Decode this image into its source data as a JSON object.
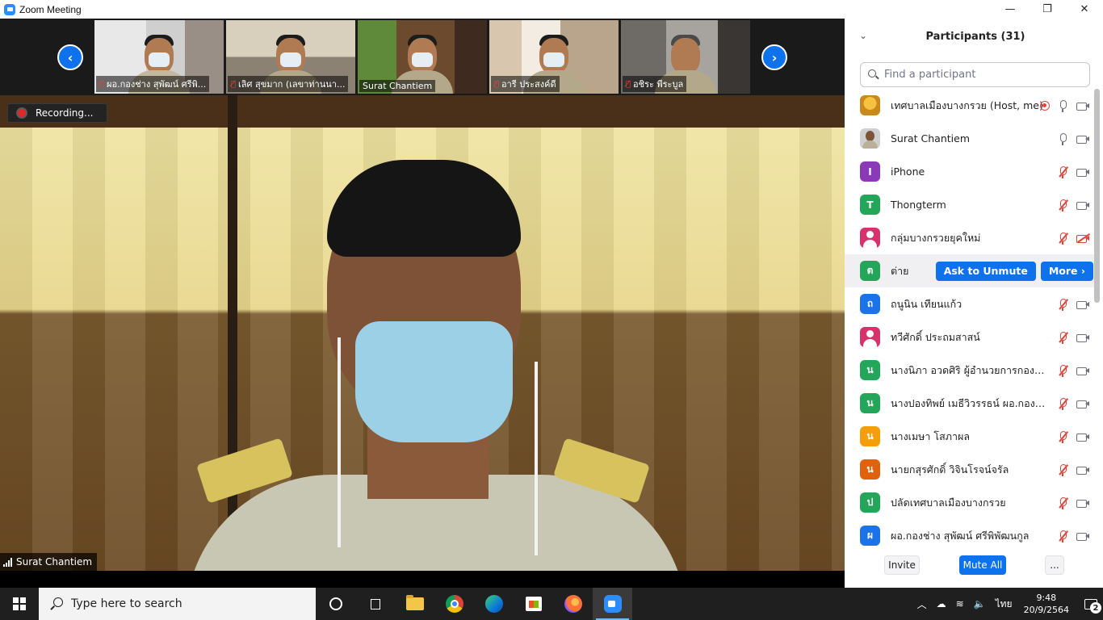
{
  "window": {
    "title": "Zoom Meeting",
    "minimize": "—",
    "maximize": "❐",
    "close": "✕"
  },
  "thumbnails": [
    {
      "name": "ผอ.กองช่าง สุพัฒน์ ศรีพิ...",
      "muted": true
    },
    {
      "name": "เลิศ สุขมาก (เลขาท่านนา...",
      "muted": true
    },
    {
      "name": "Surat Chantiem",
      "muted": false,
      "active": true
    },
    {
      "name": "อารี ประสงค์ดี",
      "muted": true
    },
    {
      "name": "อชิระ พีระบูล",
      "muted": true
    }
  ],
  "nav": {
    "prev": "‹",
    "next": "›"
  },
  "recording": {
    "label": "Recording..."
  },
  "speaker": {
    "name": "Surat Chantiem"
  },
  "panel": {
    "title": "Participants (31)",
    "collapse": "⌄",
    "search_placeholder": "Find a participant",
    "participants": [
      {
        "name": "เทศบาลเมืองบางกรวย (Host, me)",
        "avatar_letter": "",
        "avatar_color": "#f5c242",
        "avatar_type": "photo-host",
        "mic": "on",
        "cam": "on",
        "recording": true
      },
      {
        "name": "Surat Chantiem",
        "avatar_letter": "",
        "avatar_color": "#cfcfcf",
        "avatar_type": "photo-person",
        "mic": "on",
        "cam": "on"
      },
      {
        "name": "iPhone",
        "avatar_letter": "I",
        "avatar_color": "#8a3ab9",
        "mic": "muted",
        "cam": "on"
      },
      {
        "name": "Thongterm",
        "avatar_letter": "T",
        "avatar_color": "#23a55a",
        "mic": "muted",
        "cam": "on"
      },
      {
        "name": "กลุ่มบางกรวยยุคใหม่",
        "avatar_letter": "",
        "avatar_color": "#d6336c",
        "avatar_type": "silhouette",
        "mic": "muted",
        "cam": "off"
      },
      {
        "name": "ต่าย",
        "avatar_letter": "ต",
        "avatar_color": "#23a55a",
        "hover": true,
        "actions": [
          "Ask to Unmute",
          "More ›"
        ]
      },
      {
        "name": "ถนูนิน เทียนแก้ว",
        "avatar_letter": "ถ",
        "avatar_color": "#1a73e8",
        "mic": "muted",
        "cam": "on"
      },
      {
        "name": "ทวีศักดิ์ ประถมสาสน์",
        "avatar_letter": "",
        "avatar_color": "#d6336c",
        "avatar_type": "silhouette",
        "mic": "muted",
        "cam": "on"
      },
      {
        "name": "นางนิภา อวดศิริ  ผู้อำนวยการกองคลัง",
        "avatar_letter": "น",
        "avatar_color": "#23a55a",
        "mic": "muted",
        "cam": "on"
      },
      {
        "name": "นางปองทิพย์ เมธีวิวรรธน์ ผอ.กองสวัส...",
        "avatar_letter": "น",
        "avatar_color": "#23a55a",
        "mic": "muted",
        "cam": "on"
      },
      {
        "name": "นางเมษา  โสภาผล",
        "avatar_letter": "น",
        "avatar_color": "#f59e0b",
        "mic": "muted",
        "cam": "on"
      },
      {
        "name": "นายกสุรศักดิ์ วิจินโรจน์จรัล",
        "avatar_letter": "น",
        "avatar_color": "#e0620d",
        "mic": "muted",
        "cam": "on"
      },
      {
        "name": "ปลัดเทศบาลเมืองบางกรวย",
        "avatar_letter": "ป",
        "avatar_color": "#23a55a",
        "mic": "muted",
        "cam": "on"
      },
      {
        "name": "ผอ.กองช่าง สุพัฒน์ ศรีพิพัฒนกูล",
        "avatar_letter": "ผ",
        "avatar_color": "#1a73e8",
        "mic": "muted",
        "cam": "on"
      }
    ],
    "footer": {
      "invite": "Invite",
      "mute_all": "Mute All",
      "more": "..."
    }
  },
  "taskbar": {
    "search_text": "Type here to search",
    "language": "ไทย",
    "time": "9:48",
    "date": "20/9/2564",
    "notifications": "2"
  }
}
